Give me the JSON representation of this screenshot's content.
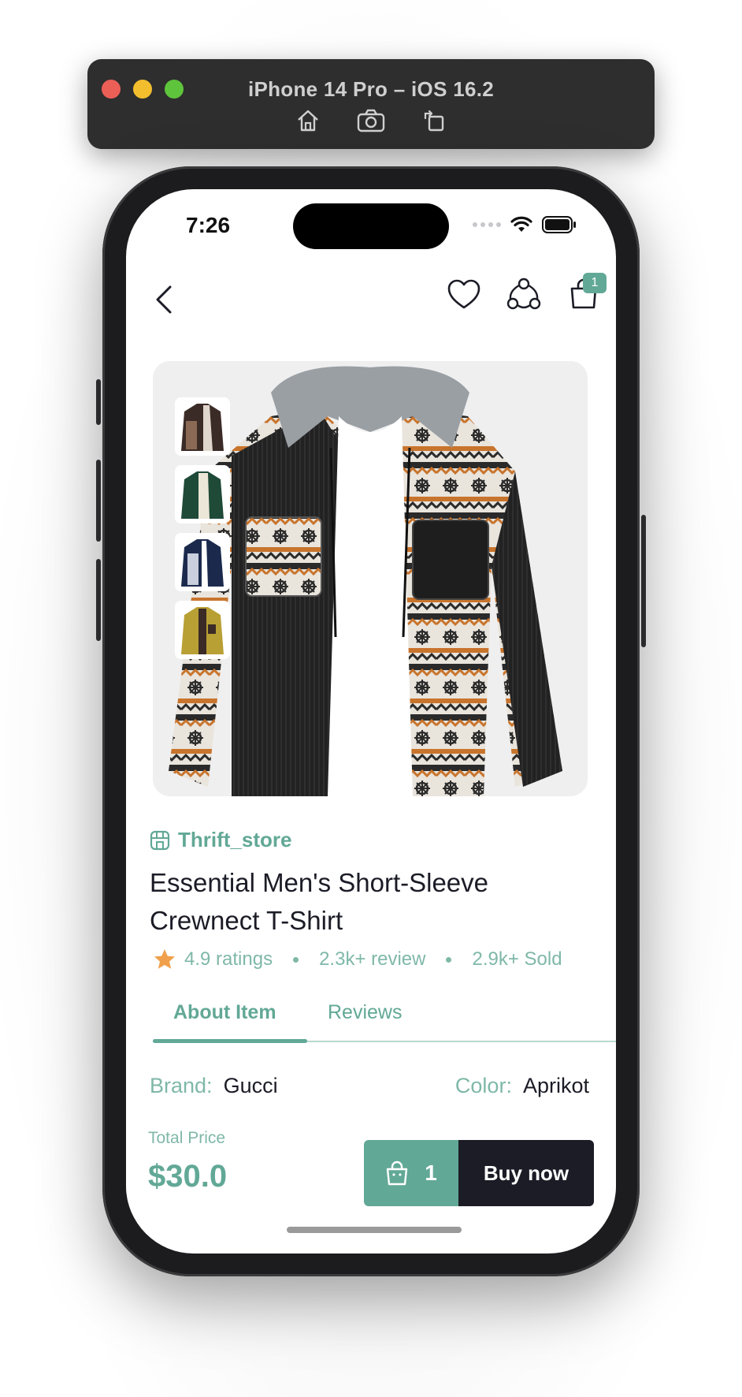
{
  "simulator": {
    "title": "iPhone 14 Pro – iOS 16.2",
    "icons": [
      "home-icon",
      "screenshot-icon",
      "rotate-icon"
    ]
  },
  "status_bar": {
    "time": "7:26"
  },
  "header": {
    "cart_count": "1",
    "icons": [
      "back-chevron-icon",
      "heart-icon",
      "share-icon",
      "shopping-bag-icon"
    ]
  },
  "product": {
    "store": "Thrift_store",
    "title": "Essential Men's Short-Sleeve Crewnect T-Shirt",
    "rating": "4.9 ratings",
    "reviews": "2.3k+ review",
    "sold": "2.9k+ Sold"
  },
  "tabs": {
    "about": "About Item",
    "reviews": "Reviews"
  },
  "attributes": {
    "brand_label": "Brand:",
    "brand_value": "Gucci",
    "color_label": "Color:",
    "color_value": "Aprikot"
  },
  "checkout": {
    "total_label": "Total Price",
    "total_price": "$30.0",
    "quantity": "1",
    "buy_label": "Buy now"
  },
  "colors": {
    "accent": "#62a896",
    "dark": "#1b1c26",
    "muted_accent": "#7fb8a8"
  }
}
